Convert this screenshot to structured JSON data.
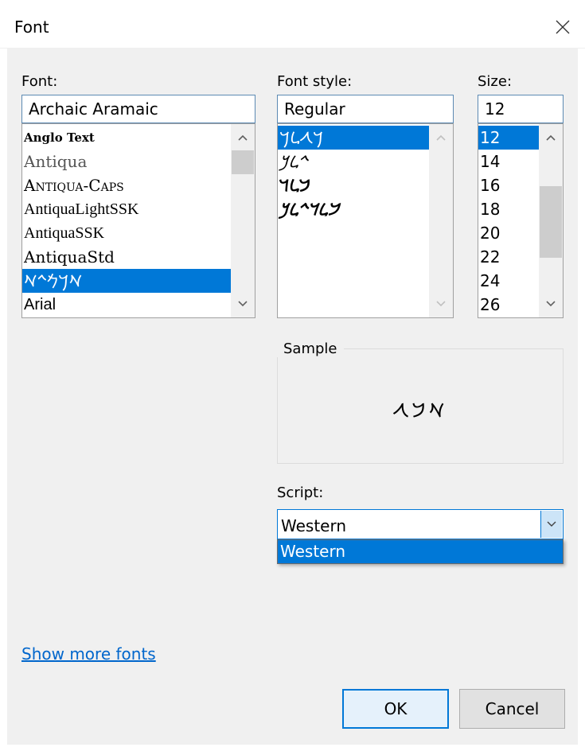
{
  "window": {
    "title": "Font"
  },
  "font": {
    "label": "Font:",
    "value": "Archaic Aramaic",
    "items": [
      "Anglo Text",
      "Antiqua",
      "Antiqua-Caps",
      "AntiquaLightSSK",
      "AntiquaSSK",
      "AntiquaStd",
      "𐡀𐡓𐡌𐡉𐡀",
      "Arial"
    ],
    "selected_index": 6
  },
  "style": {
    "label": "Font style:",
    "value": "Regular",
    "items": [
      "𐡓𐡂𐡋𐡓",
      "𐡉𐡋𐡊",
      "𐡁𐡋𐡃",
      "𐡁𐡋𐡃𐡉𐡋𐡊"
    ],
    "selected_index": 0
  },
  "size": {
    "label": "Size:",
    "value": "12",
    "items": [
      "12",
      "14",
      "16",
      "18",
      "20",
      "22",
      "24",
      "26"
    ],
    "selected_index": 0
  },
  "sample": {
    "label": "Sample",
    "text": "𐡀𐡁𐡂"
  },
  "script": {
    "label": "Script:",
    "value": "Western",
    "options": [
      "Western"
    ]
  },
  "link": {
    "label": "Show more fonts"
  },
  "buttons": {
    "ok": "OK",
    "cancel": "Cancel"
  },
  "colors": {
    "accent": "#0078d7",
    "link": "#0066cc",
    "face": "#f0f0f0"
  }
}
